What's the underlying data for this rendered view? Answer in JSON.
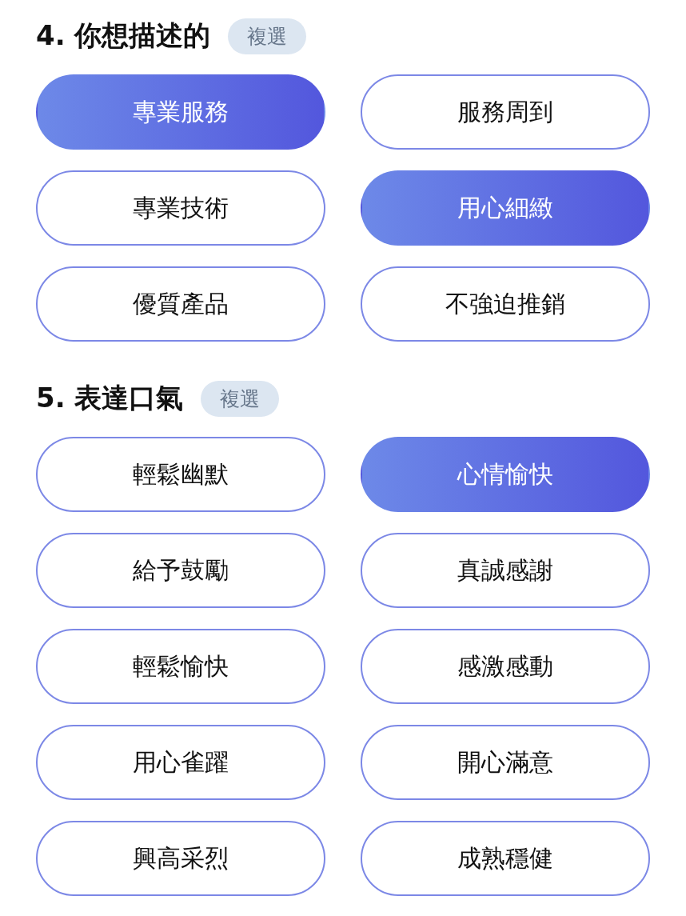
{
  "sections": [
    {
      "title": "4. 你想描述的",
      "badge": "複選",
      "options": [
        {
          "label": "專業服務",
          "selected": true
        },
        {
          "label": "服務周到",
          "selected": false
        },
        {
          "label": "專業技術",
          "selected": false
        },
        {
          "label": "用心細緻",
          "selected": true
        },
        {
          "label": "優質產品",
          "selected": false
        },
        {
          "label": "不強迫推銷",
          "selected": false
        }
      ]
    },
    {
      "title": "5. 表達口氣",
      "badge": "複選",
      "options": [
        {
          "label": "輕鬆幽默",
          "selected": false
        },
        {
          "label": "心情愉快",
          "selected": true
        },
        {
          "label": "給予鼓勵",
          "selected": false
        },
        {
          "label": "真誠感謝",
          "selected": false
        },
        {
          "label": "輕鬆愉快",
          "selected": false
        },
        {
          "label": "感激感動",
          "selected": false
        },
        {
          "label": "用心雀躍",
          "selected": false
        },
        {
          "label": "開心滿意",
          "selected": false
        },
        {
          "label": "興高采烈",
          "selected": false
        },
        {
          "label": "成熟穩健",
          "selected": false
        }
      ]
    }
  ]
}
